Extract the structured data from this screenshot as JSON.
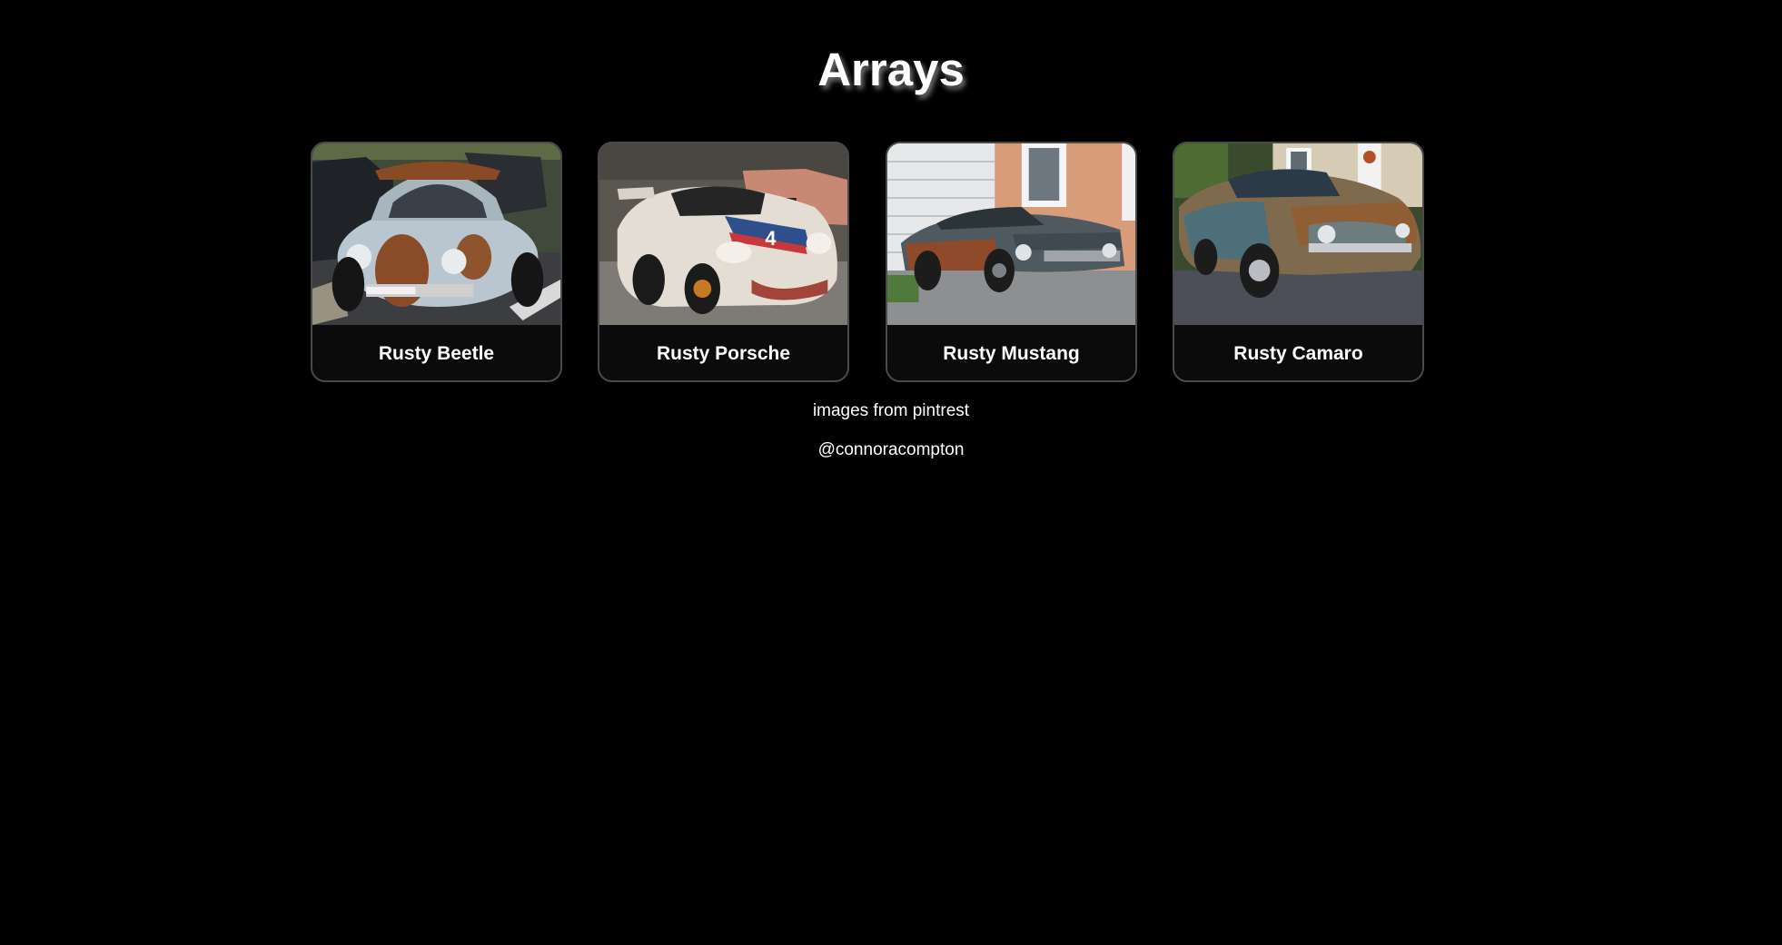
{
  "page": {
    "title": "Arrays"
  },
  "cards": [
    {
      "label": "Rusty Beetle",
      "image": "rusty-beetle-photo"
    },
    {
      "label": "Rusty Porsche",
      "image": "rusty-porsche-photo"
    },
    {
      "label": "Rusty Mustang",
      "image": "rusty-mustang-photo"
    },
    {
      "label": "Rusty Camaro",
      "image": "rusty-camaro-photo"
    }
  ],
  "footer": {
    "source": "images from pintrest",
    "credit": "@connoracompton"
  },
  "colors": {
    "background": "#000000",
    "card_background": "#0b0b0b",
    "card_border": "#4a4a4a",
    "text": "#ffffff"
  }
}
